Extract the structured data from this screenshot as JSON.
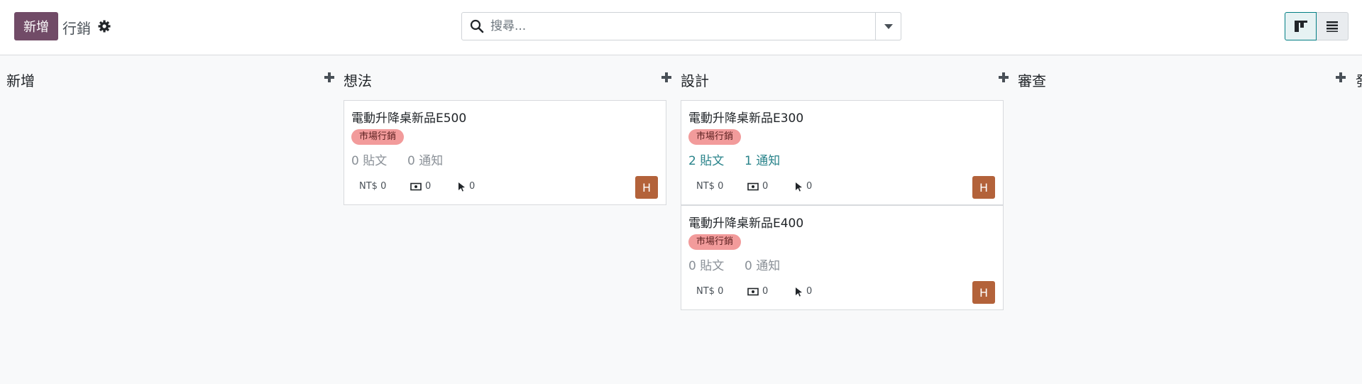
{
  "toolbar": {
    "new_label": "新增",
    "breadcrumb": "行銷",
    "search_placeholder": "搜尋...",
    "accent_color": "#714b67"
  },
  "columns": [
    {
      "title": "新增"
    },
    {
      "title": "想法"
    },
    {
      "title": "設計"
    },
    {
      "title": "審查"
    },
    {
      "title": "發"
    }
  ],
  "cards": [
    {
      "title": "電動升降桌新品E500",
      "tag": "市場行銷",
      "posts": "0 貼文",
      "notices": "0 通知",
      "revenue": "NT$ 0",
      "expense": "0",
      "clicks": "0",
      "avatar": "H"
    },
    {
      "title": "電動升降桌新品E300",
      "tag": "市場行銷",
      "posts": "2 貼文",
      "notices": "1 通知",
      "revenue": "NT$ 0",
      "expense": "0",
      "clicks": "0",
      "avatar": "H"
    },
    {
      "title": "電動升降桌新品E400",
      "tag": "市場行銷",
      "posts": "0 貼文",
      "notices": "0 通知",
      "revenue": "NT$ 0",
      "expense": "0",
      "clicks": "0",
      "avatar": "H"
    }
  ]
}
